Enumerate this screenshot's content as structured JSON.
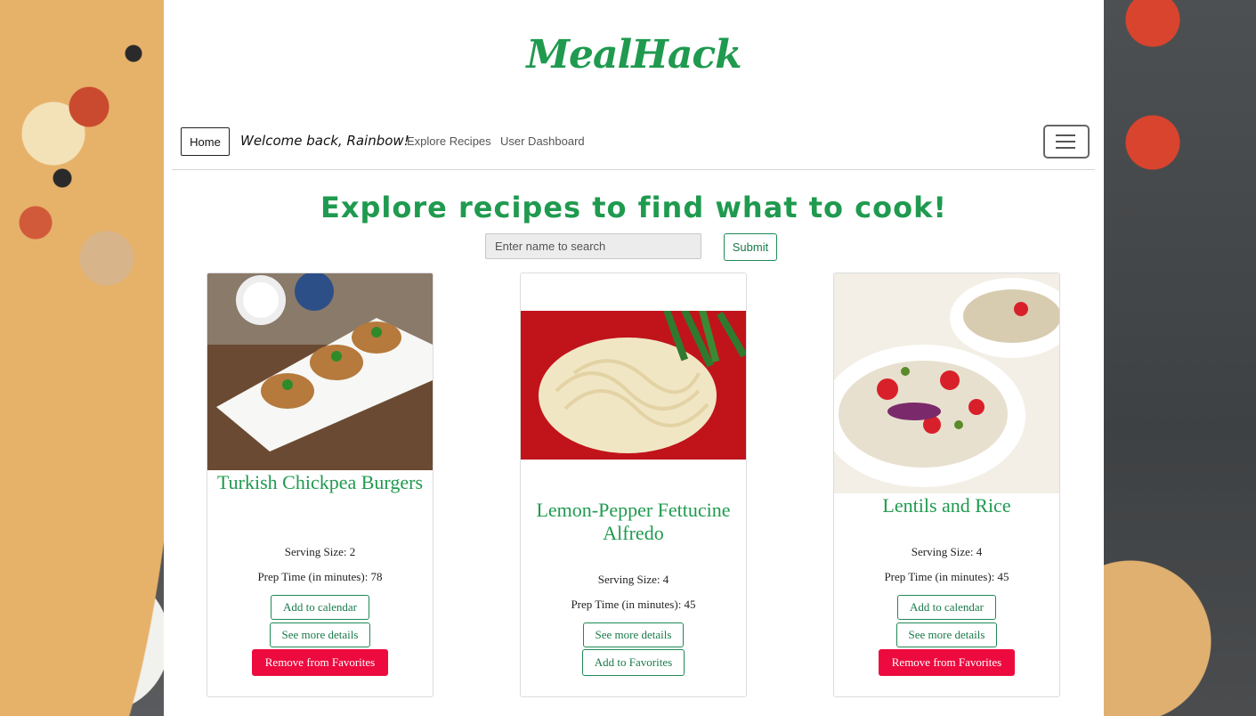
{
  "app": {
    "logo": "MealHack"
  },
  "nav": {
    "home_label": "Home",
    "welcome": "Welcome back, Rainbow!",
    "links": [
      "Explore Recipes",
      "User Dashboard"
    ]
  },
  "main": {
    "heading": "Explore recipes to find what to cook!",
    "search": {
      "placeholder": "Enter name to search",
      "value": ""
    },
    "submit_label": "Submit"
  },
  "recipes": [
    {
      "title": "Turkish Chickpea Burgers",
      "serving": "Serving Size: 2",
      "prep": "Prep Time (in minutes): 78",
      "buttons": [
        "Add to calendar",
        "See more details"
      ],
      "favorite_button": "Remove from Favorites"
    },
    {
      "title": "Lemon-Pepper Fettucine Alfredo",
      "serving": "Serving Size: 4",
      "prep": "Prep Time (in minutes): 45",
      "buttons": [
        "See more details"
      ],
      "favorite_button": "Add to Favorites"
    },
    {
      "title": "Lentils and Rice",
      "serving": "Serving Size: 4",
      "prep": "Prep Time (in minutes): 45",
      "buttons": [
        "Add to calendar",
        "See more details"
      ],
      "favorite_button": "Remove from Favorites"
    }
  ],
  "colors": {
    "brand_green": "#1f9a4f",
    "danger": "#ed0a3f"
  }
}
